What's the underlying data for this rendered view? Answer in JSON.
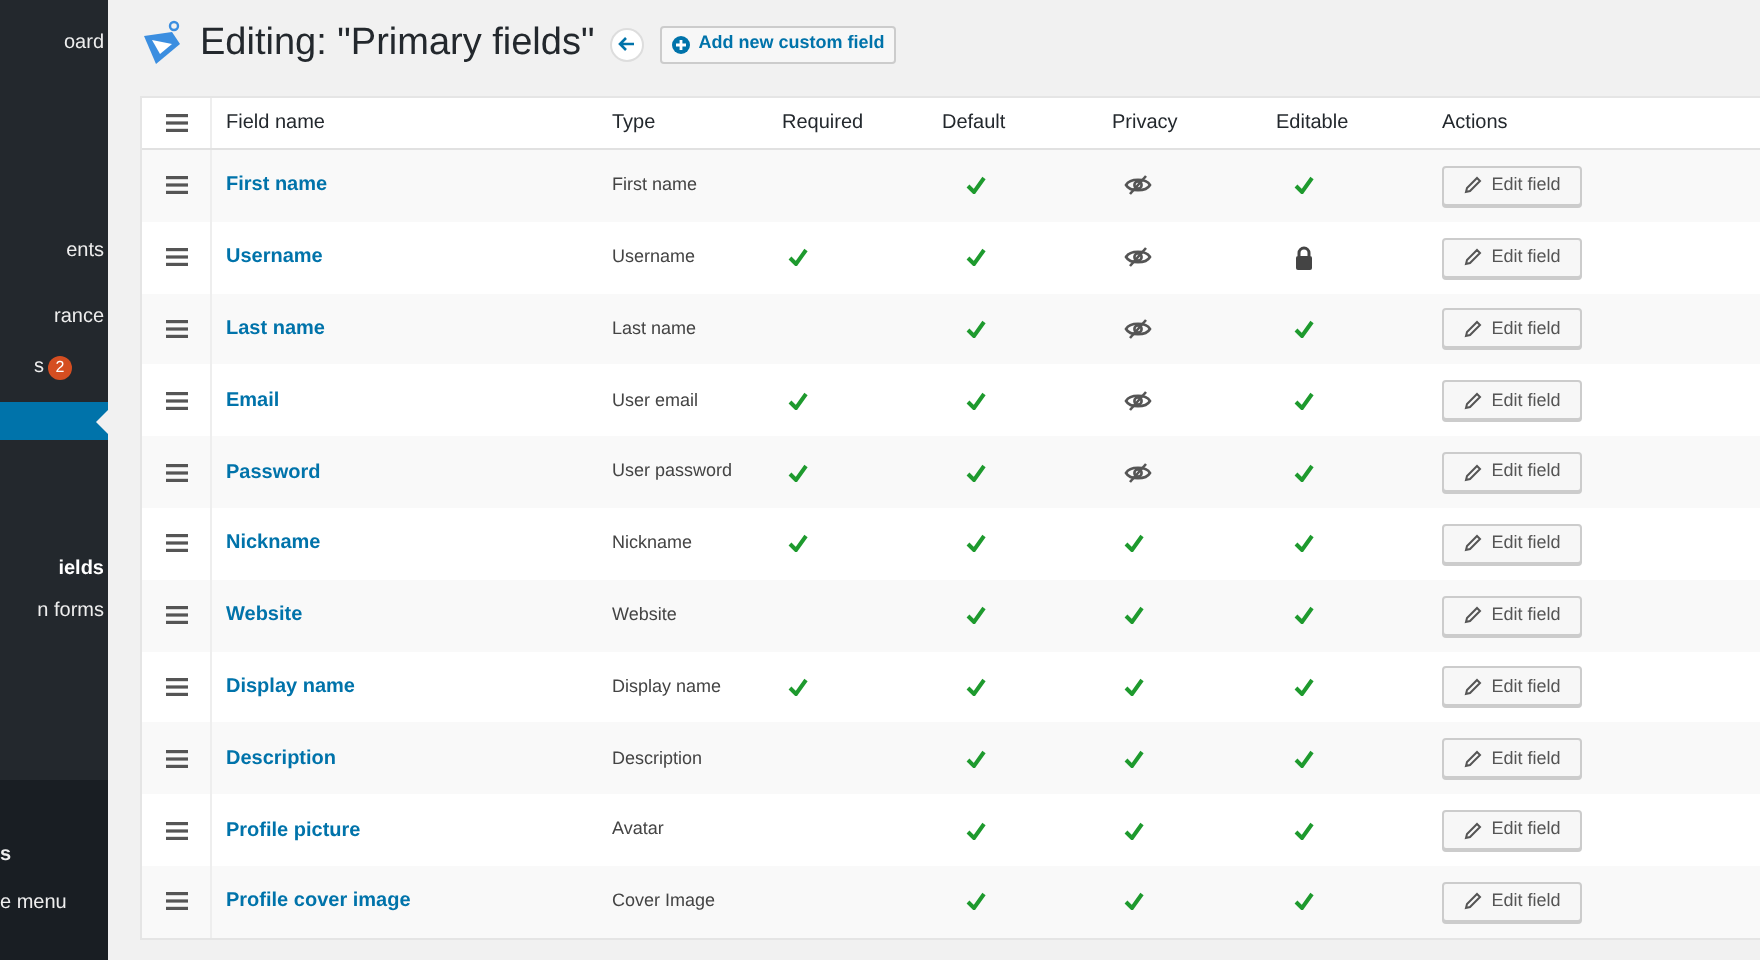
{
  "sidebar": {
    "items": [
      {
        "label": "oard",
        "selected": false
      },
      {
        "label": "ents",
        "selected": false
      },
      {
        "label": "rance",
        "selected": false
      },
      {
        "label": "s",
        "badge": "2",
        "selected": false
      },
      {
        "selected": true
      },
      {
        "label": "ields",
        "selected": false,
        "bold": true
      },
      {
        "label": "n forms",
        "selected": false
      }
    ],
    "footer_items": [
      {
        "label": "s"
      },
      {
        "label": "e menu"
      }
    ]
  },
  "header": {
    "title": "Editing: \"Primary fields\"",
    "add_button": "Add new custom field"
  },
  "table": {
    "columns": [
      "Field name",
      "Type",
      "Required",
      "Default",
      "Privacy",
      "Editable",
      "Actions"
    ],
    "rows": [
      {
        "name": "First name",
        "type": "First name",
        "required": false,
        "default": true,
        "private": true,
        "locked": false,
        "action": "Edit field"
      },
      {
        "name": "Username",
        "type": "Username",
        "required": true,
        "default": true,
        "private": true,
        "locked": true,
        "action": "Edit field"
      },
      {
        "name": "Last name",
        "type": "Last name",
        "required": false,
        "default": true,
        "private": true,
        "locked": false,
        "action": "Edit field"
      },
      {
        "name": "Email",
        "type": "User email",
        "required": true,
        "default": true,
        "private": true,
        "locked": false,
        "action": "Edit field"
      },
      {
        "name": "Password",
        "type": "User password",
        "required": true,
        "default": true,
        "private": true,
        "locked": false,
        "action": "Edit field"
      },
      {
        "name": "Nickname",
        "type": "Nickname",
        "required": true,
        "default": true,
        "private": false,
        "locked": false,
        "action": "Edit field"
      },
      {
        "name": "Website",
        "type": "Website",
        "required": false,
        "default": true,
        "private": false,
        "locked": false,
        "action": "Edit field"
      },
      {
        "name": "Display name",
        "type": "Display name",
        "required": true,
        "default": true,
        "private": false,
        "locked": false,
        "action": "Edit field"
      },
      {
        "name": "Description",
        "type": "Description",
        "required": false,
        "default": true,
        "private": false,
        "locked": false,
        "action": "Edit field"
      },
      {
        "name": "Profile picture",
        "type": "Avatar",
        "required": false,
        "default": true,
        "private": false,
        "locked": false,
        "action": "Edit field"
      },
      {
        "name": "Profile cover image",
        "type": "Cover Image",
        "required": false,
        "default": true,
        "private": false,
        "locked": false,
        "action": "Edit field"
      }
    ]
  }
}
